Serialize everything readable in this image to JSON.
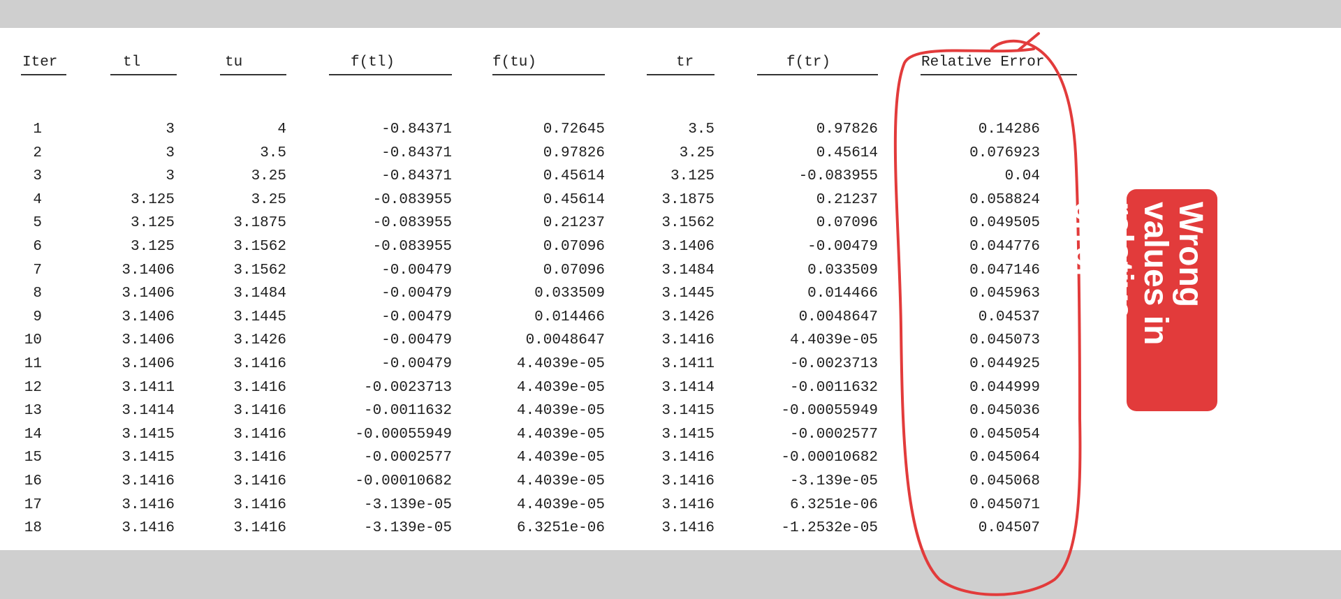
{
  "table": {
    "headers": [
      "Iter",
      "tl",
      "tu",
      "f(tl)",
      "f(tu)",
      "tr",
      "f(tr)",
      "Relative Error"
    ],
    "rows": [
      [
        "1",
        "3",
        "4",
        "-0.84371",
        "0.72645",
        "3.5",
        "0.97826",
        "0.14286"
      ],
      [
        "2",
        "3",
        "3.5",
        "-0.84371",
        "0.97826",
        "3.25",
        "0.45614",
        "0.076923"
      ],
      [
        "3",
        "3",
        "3.25",
        "-0.84371",
        "0.45614",
        "3.125",
        "-0.083955",
        "0.04"
      ],
      [
        "4",
        "3.125",
        "3.25",
        "-0.083955",
        "0.45614",
        "3.1875",
        "0.21237",
        "0.058824"
      ],
      [
        "5",
        "3.125",
        "3.1875",
        "-0.083955",
        "0.21237",
        "3.1562",
        "0.07096",
        "0.049505"
      ],
      [
        "6",
        "3.125",
        "3.1562",
        "-0.083955",
        "0.07096",
        "3.1406",
        "-0.00479",
        "0.044776"
      ],
      [
        "7",
        "3.1406",
        "3.1562",
        "-0.00479",
        "0.07096",
        "3.1484",
        "0.033509",
        "0.047146"
      ],
      [
        "8",
        "3.1406",
        "3.1484",
        "-0.00479",
        "0.033509",
        "3.1445",
        "0.014466",
        "0.045963"
      ],
      [
        "9",
        "3.1406",
        "3.1445",
        "-0.00479",
        "0.014466",
        "3.1426",
        "0.0048647",
        "0.04537"
      ],
      [
        "10",
        "3.1406",
        "3.1426",
        "-0.00479",
        "0.0048647",
        "3.1416",
        "4.4039e-05",
        "0.045073"
      ],
      [
        "11",
        "3.1406",
        "3.1416",
        "-0.00479",
        "4.4039e-05",
        "3.1411",
        "-0.0023713",
        "0.044925"
      ],
      [
        "12",
        "3.1411",
        "3.1416",
        "-0.0023713",
        "4.4039e-05",
        "3.1414",
        "-0.0011632",
        "0.044999"
      ],
      [
        "13",
        "3.1414",
        "3.1416",
        "-0.0011632",
        "4.4039e-05",
        "3.1415",
        "-0.00055949",
        "0.045036"
      ],
      [
        "14",
        "3.1415",
        "3.1416",
        "-0.00055949",
        "4.4039e-05",
        "3.1415",
        "-0.0002577",
        "0.045054"
      ],
      [
        "15",
        "3.1415",
        "3.1416",
        "-0.0002577",
        "4.4039e-05",
        "3.1416",
        "-0.00010682",
        "0.045064"
      ],
      [
        "16",
        "3.1416",
        "3.1416",
        "-0.00010682",
        "4.4039e-05",
        "3.1416",
        "-3.139e-05",
        "0.045068"
      ],
      [
        "17",
        "3.1416",
        "3.1416",
        "-3.139e-05",
        "4.4039e-05",
        "3.1416",
        "6.3251e-06",
        "0.045071"
      ],
      [
        "18",
        "3.1416",
        "3.1416",
        "-3.139e-05",
        "6.3251e-06",
        "3.1416",
        "-1.2532e-05",
        "0.04507"
      ]
    ]
  },
  "annotation": {
    "line1": "Wrong values in",
    "line2": "relative error",
    "color": "#e23b3b"
  }
}
